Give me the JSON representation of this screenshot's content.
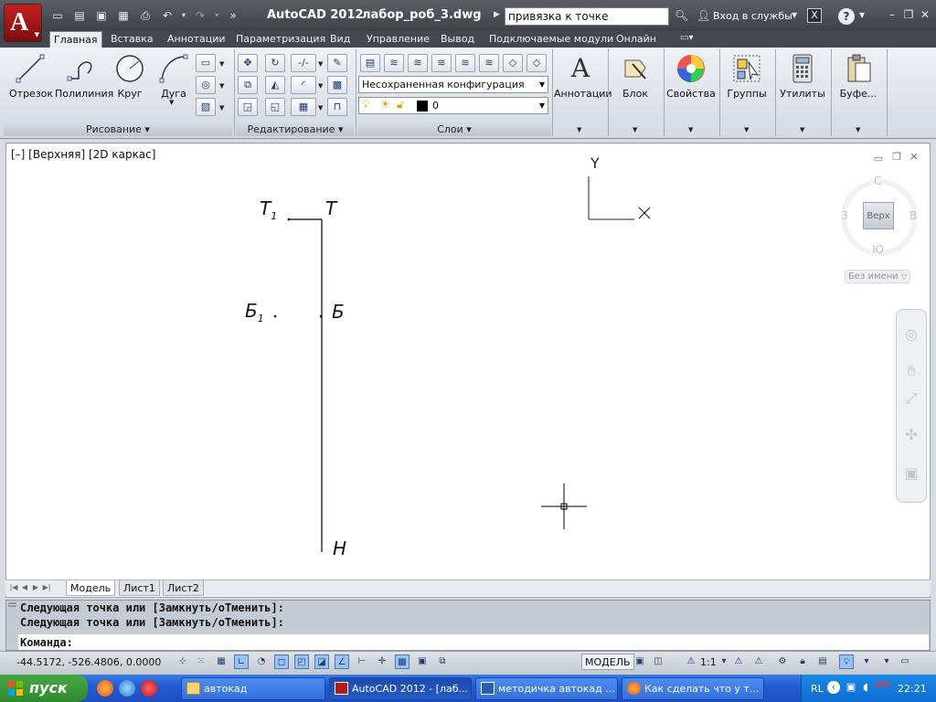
{
  "window": {
    "app_name": "AutoCAD 2012",
    "file_name": "лабор_роб_3.dwg",
    "search_value": "привязка к точке",
    "sign_in_label": "Вход в службы",
    "quick_access_icons": [
      "new-icon",
      "open-icon",
      "save-icon",
      "saveas-icon",
      "plot-icon",
      "undo-icon",
      "redo-icon"
    ]
  },
  "ribbon": {
    "tabs": [
      "Главная",
      "Вставка",
      "Аннотации",
      "Параметризация",
      "Вид",
      "Управление",
      "Вывод",
      "Подключаемые модули",
      "Онлайн"
    ],
    "active_tab": "Главная",
    "draw_tools": {
      "line": "Отрезок",
      "polyline": "Полилиния",
      "circle": "Круг",
      "arc": "Дуга"
    },
    "panels": {
      "draw": "Рисование",
      "modify": "Редактирование",
      "layers": "Слои"
    },
    "layer_state": "Несохраненная конфигурация слоев",
    "current_layer": "0",
    "right_tools": {
      "annotations": "Аннотации",
      "block": "Блок",
      "properties": "Свойства",
      "groups": "Группы",
      "utilities": "Утилиты",
      "clipboard": "Буфе..."
    }
  },
  "viewport": {
    "label": "[–] [Верхняя] [2D каркас]",
    "point_labels": {
      "t1": "Т",
      "t1_sub": "1",
      "t": "Т",
      "b1": "Б",
      "b1_sub": "1",
      "b": "Б",
      "n": "Н"
    },
    "ucs": {
      "y": "Y",
      "x": "X"
    },
    "viewcube": {
      "face": "Верх",
      "north": "С",
      "south": "Ю",
      "west": "З",
      "east": "В",
      "ucs_name": "Без имени"
    }
  },
  "layout_tabs": [
    "Модель",
    "Лист1",
    "Лист2"
  ],
  "active_layout": "Модель",
  "command": {
    "history": [
      "Следующая точка или [Замкнуть/оТменить]:",
      "Следующая точка или [Замкнуть/оТменить]:"
    ],
    "prompt": "Команда:"
  },
  "status": {
    "coordinates": "-44.5172, -526.4806, 0.0000",
    "model_label": "МОДЕЛЬ",
    "scale": "1:1"
  },
  "taskbar": {
    "start_label": "пуск",
    "tasks": [
      "автокад",
      "AutoCAD 2012 - [лаб...",
      "методичка автокад ...",
      "Как сделать что у т..."
    ],
    "language": "RL",
    "clock": "22:21"
  },
  "colors": {
    "titlebar": "#45494f",
    "ribbon": "#e3e7ed",
    "viewport": "#ffffff",
    "taskbar": "#245bd1",
    "start": "#3a9a37",
    "autocad_red": "#b71c1c"
  }
}
